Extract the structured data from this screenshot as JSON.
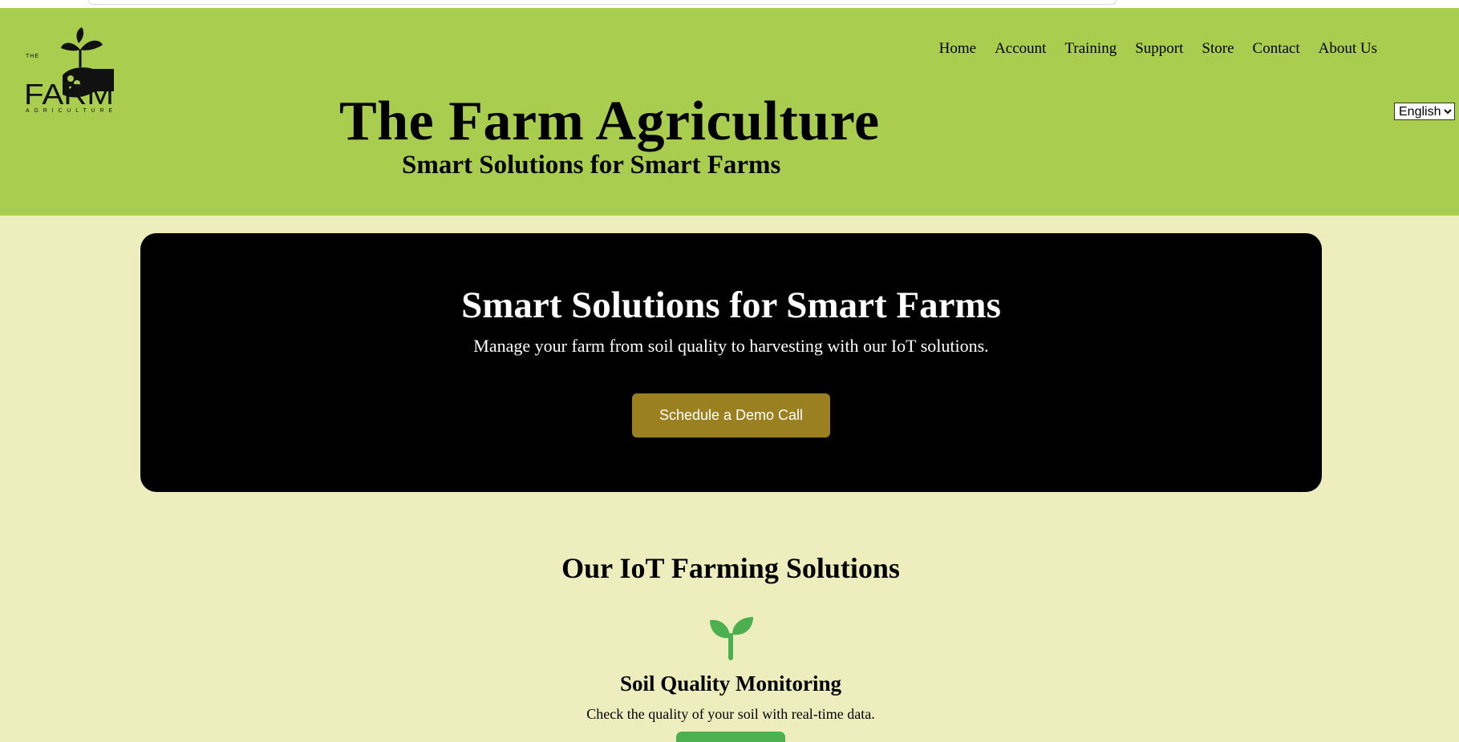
{
  "header": {
    "title": "The Farm Agriculture",
    "subtitle": "Smart Solutions for Smart Farms",
    "logo": {
      "icon": "farm-hand-sprout-logo",
      "text_the": "THE",
      "text_farm": "FARM",
      "text_agriculture": "AGRICULTURE"
    },
    "nav": [
      "Home",
      "Account",
      "Training",
      "Support",
      "Store",
      "Contact",
      "About Us"
    ],
    "language": {
      "selected": "English"
    }
  },
  "hero": {
    "title": "Smart Solutions for Smart Farms",
    "description": "Manage your farm from soil quality to harvesting with our IoT solutions.",
    "cta_label": "Schedule a Demo Call"
  },
  "solutions": {
    "title": "Our IoT Farming Solutions",
    "items": [
      {
        "icon": "sprout-icon",
        "title": "Soil Quality Monitoring",
        "description": "Check the quality of your soil with real-time data."
      }
    ]
  },
  "colors": {
    "header_bg": "#a9cd4f",
    "page_bg": "#eeedbd",
    "hero_bg": "#000000",
    "cta_bg": "#9b8021",
    "accent_green": "#4caf50"
  }
}
